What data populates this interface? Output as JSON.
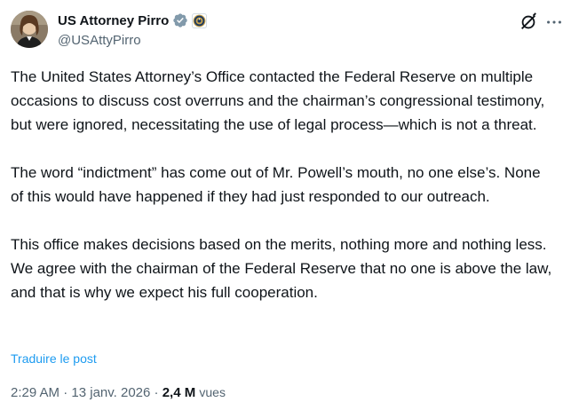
{
  "author": {
    "display_name": "US Attorney Pirro",
    "handle": "@USAttyPirro",
    "avatar_icon": "profile-photo",
    "verified_icon": "verified-badge-icon",
    "affiliate_icon": "doj-seal-icon"
  },
  "actions": {
    "grok_icon": "grok-icon",
    "more_icon": "more-options-icon"
  },
  "tweet": {
    "paragraphs": [
      "The United States Attorney’s Office contacted the Federal Reserve on multiple occasions to discuss cost overruns and the chairman’s congressional testimony, but were ignored, necessitating the use of legal process—which is not a threat.",
      "The word “indictment” has come out of Mr. Powell’s mouth, no one else’s. None of this would have happened if they had just responded to our outreach.",
      "This office makes decisions based on the merits, nothing more and nothing less. We agree with the chairman of the Federal Reserve that no one is above the law, and that is why we expect his full cooperation."
    ],
    "translate_label": "Traduire le post"
  },
  "meta": {
    "time": "2:29 AM",
    "separator": " · ",
    "date": "13 janv. 2026",
    "views_count": "2,4 M",
    "views_label": "vues"
  },
  "colors": {
    "text": "#0f1419",
    "secondary": "#536471",
    "link": "#1d9bf0",
    "verified": "#829aab"
  }
}
